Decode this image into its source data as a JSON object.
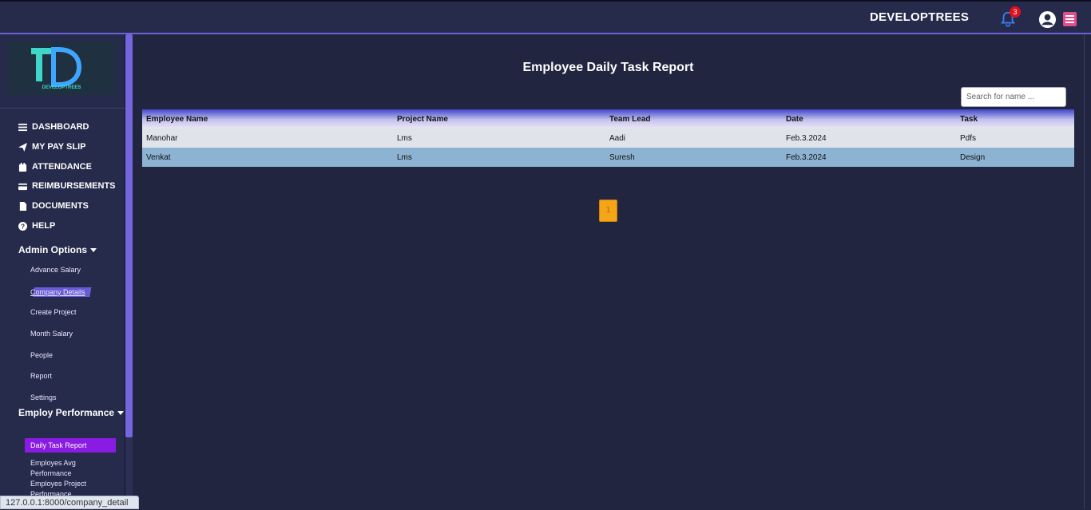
{
  "header": {
    "brand": "DEVELOPTREES",
    "notification_count": "3"
  },
  "sidebar": {
    "logo_text": "DEVELOPTREES",
    "nav": [
      {
        "label": "DASHBOARD",
        "icon": "list-icon"
      },
      {
        "label": "MY PAY SLIP",
        "icon": "paper-plane-icon"
      },
      {
        "label": "ATTENDANCE",
        "icon": "calendar-icon"
      },
      {
        "label": "REIMBURSEMENTS",
        "icon": "credit-card-icon"
      },
      {
        "label": "DOCUMENTS",
        "icon": "document-icon"
      },
      {
        "label": "HELP",
        "icon": "question-circle-icon"
      }
    ],
    "admin_options": {
      "label": "Admin Options",
      "items": [
        "Advance Salary",
        "Company Details",
        "Create Project",
        "Month Salary",
        "People",
        "Report",
        "Settings"
      ]
    },
    "employ_performance": {
      "label": "Employ Performance",
      "items": [
        "Daily Task Report",
        "Employes Avg Performance",
        "Employes Project Performance"
      ]
    }
  },
  "status_bar": {
    "url": "127.0.0.1:8000/company_detail"
  },
  "main": {
    "title": "Employee Daily Task Report",
    "search_placeholder": "Search for name ...",
    "table": {
      "columns": [
        "Employee Name",
        "Project Name",
        "Team Lead",
        "Date",
        "Task"
      ],
      "rows": [
        [
          "Manohar",
          "Lms",
          "Aadi",
          "Feb.3.2024",
          "Pdfs"
        ],
        [
          "Venkat",
          "Lms",
          "Suresh",
          "Feb.3.2024",
          "Design"
        ]
      ]
    },
    "pagination": {
      "current_page": "1"
    }
  },
  "colors": {
    "background": "#21253f",
    "sidebar": "#262a4b",
    "accent": "#7566e0",
    "active_item": "#8a1be2",
    "pager": "#f5a519"
  }
}
